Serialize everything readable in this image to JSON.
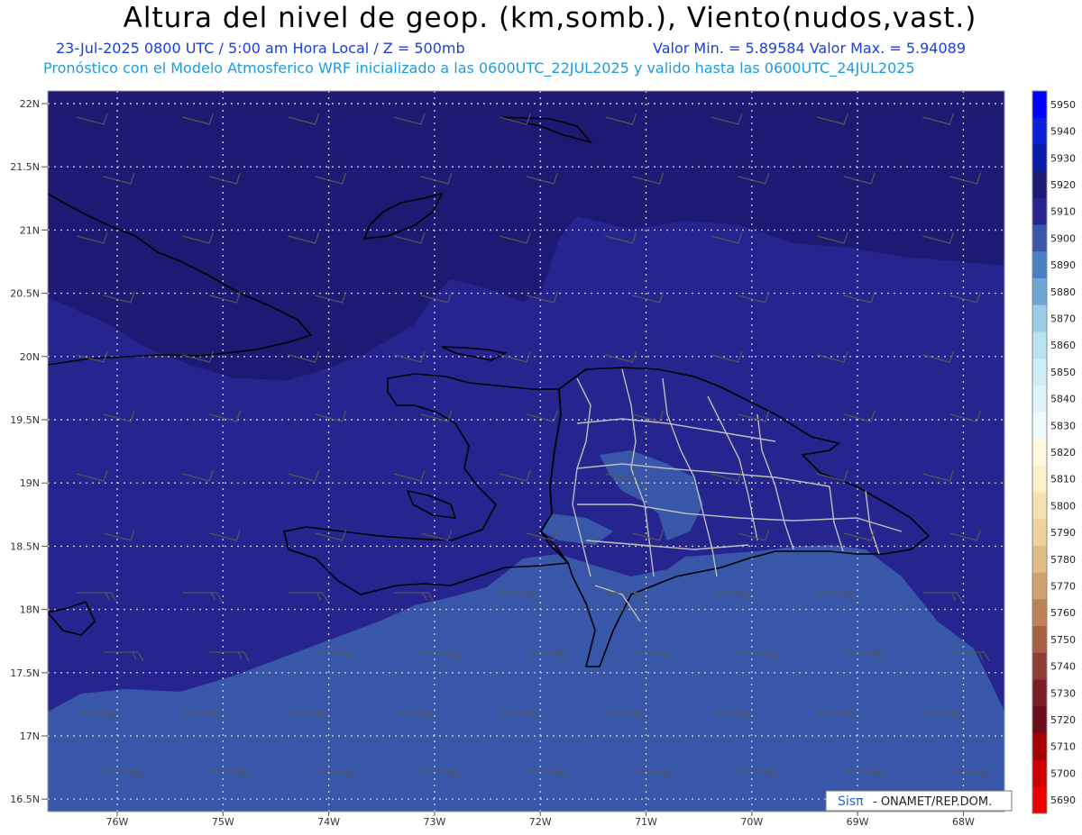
{
  "header": {
    "title": "Altura del nivel de geop. (km,somb.), Viento(nudos,vast.)",
    "date_time": "23-Jul-2025   0800 UTC / 5:00 am Hora Local / Z = 500mb",
    "minmax": "Valor Min. = 5.89584   Valor Max. = 5.94089",
    "model_info": "Pronóstico con el Modelo Atmosferico WRF inicializado a las 0600UTC_22JUL2025 y valido hasta las   0600UTC_24JUL2025"
  },
  "map": {
    "lat_labels": [
      "22N",
      "21.5N",
      "21N",
      "20.5N",
      "20N",
      "19.5N",
      "19N",
      "18.5N",
      "18N",
      "17.5N",
      "17N",
      "16.5N"
    ],
    "lon_labels": [
      "76W",
      "75W",
      "74W",
      "73W",
      "72W",
      "71W",
      "70W",
      "69W",
      "68W"
    ],
    "colors": {
      "level_5920": "#1e1a73",
      "level_5910": "#26258f",
      "level_5900": "#3957a8",
      "land_outline": "#000000",
      "province_outline": "#bdbdbd",
      "barb": "#555555"
    }
  },
  "colorbar": {
    "levels": [
      "5950",
      "5940",
      "5930",
      "5920",
      "5910",
      "5900",
      "5890",
      "5880",
      "5870",
      "5860",
      "5850",
      "5840",
      "5830",
      "5820",
      "5810",
      "5800",
      "5790",
      "5780",
      "5770",
      "5760",
      "5750",
      "5740",
      "5730",
      "5720",
      "5710",
      "5700",
      "5690"
    ],
    "colors": [
      "#0000ff",
      "#0a1fd6",
      "#0d1aa8",
      "#1e1a73",
      "#26258f",
      "#3957a8",
      "#4a7fc0",
      "#6fa6d4",
      "#9ccbe6",
      "#b7e2ee",
      "#cdeef6",
      "#dff4fa",
      "#eefafc",
      "#fffbe0",
      "#fbf0c8",
      "#f4e2b0",
      "#ecd39d",
      "#e0bd85",
      "#cfa070",
      "#bd8257",
      "#a86045",
      "#8e3e36",
      "#7a1e2a",
      "#6a0d1d",
      "#a50000",
      "#cc0000",
      "#ee0000"
    ]
  },
  "credit": {
    "brand": "Sisπ",
    "text": " - ONAMET/REP.DOM."
  }
}
